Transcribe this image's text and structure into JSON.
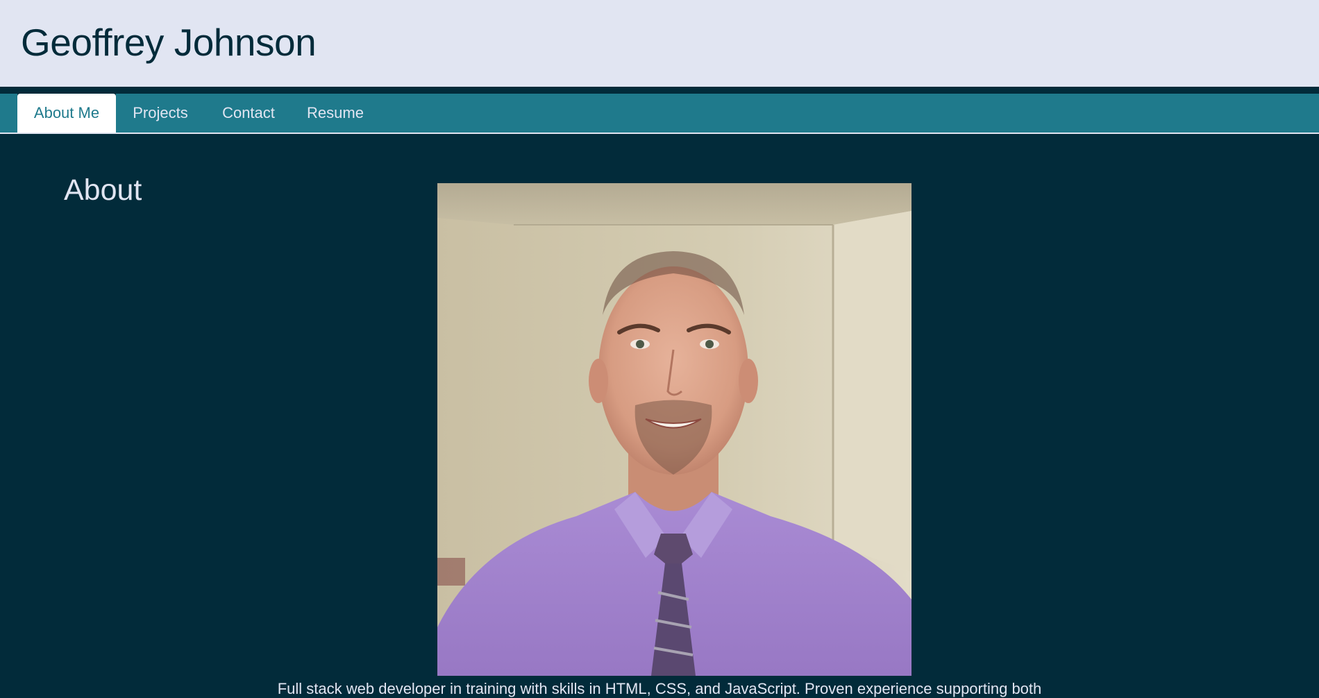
{
  "header": {
    "title": "Geoffrey Johnson"
  },
  "nav": {
    "tabs": [
      {
        "label": "About Me",
        "active": true
      },
      {
        "label": "Projects",
        "active": false
      },
      {
        "label": "Contact",
        "active": false
      },
      {
        "label": "Resume",
        "active": false
      }
    ]
  },
  "main": {
    "heading": "About",
    "photo_alt": "portrait-photo",
    "bio": "Full stack web developer in training with skills in HTML, CSS, and JavaScript. Proven experience supporting both"
  },
  "colors": {
    "header_bg": "#e1e5f2",
    "page_bg": "#022b3a",
    "nav_bg": "#1f7a8c",
    "text_light": "#e1e5f2",
    "title_dark": "#022b3a"
  }
}
